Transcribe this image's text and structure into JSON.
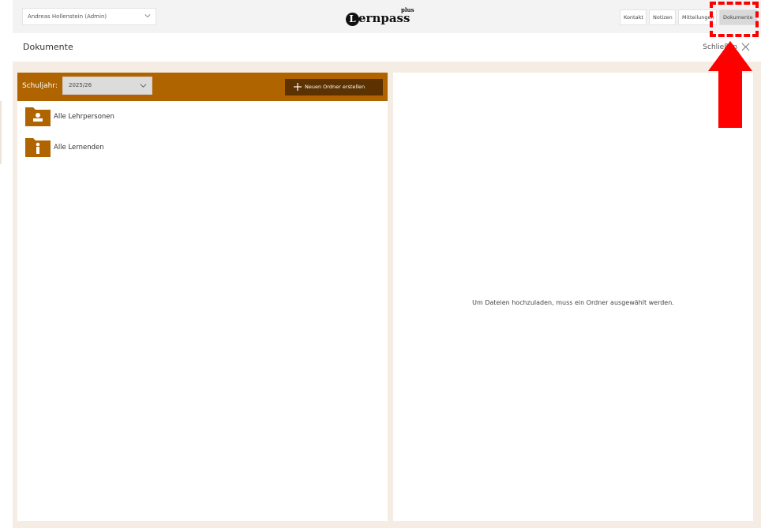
{
  "header": {
    "user_select": "Andreas Hollenstein (Admin)",
    "logo_text": "ernpass",
    "logo_initial": "L",
    "logo_plus": "plus",
    "nav": [
      "Kontakt",
      "Notizen",
      "Mitteilungen",
      "Dokumente"
    ],
    "active_nav": "Dokumente"
  },
  "page": {
    "title": "Dokumente",
    "close_label": "Schließen"
  },
  "left_panel": {
    "year_label": "Schuljahr:",
    "year_value": "2025/26",
    "new_folder_label": "Neuen Ordner erstellen",
    "folders": [
      {
        "label": "Alle Lehrpersonen",
        "icon": "teacher-folder-icon"
      },
      {
        "label": "Alle Lernenden",
        "icon": "student-folder-icon"
      }
    ]
  },
  "right_panel": {
    "empty_message": "Um Dateien hochzuladen, muss ein Ordner ausgewählt werden."
  },
  "colors": {
    "accent": "#b06400",
    "button_dark": "#5c3200",
    "background": "#f5ede4",
    "annotation": "#ff0000"
  }
}
